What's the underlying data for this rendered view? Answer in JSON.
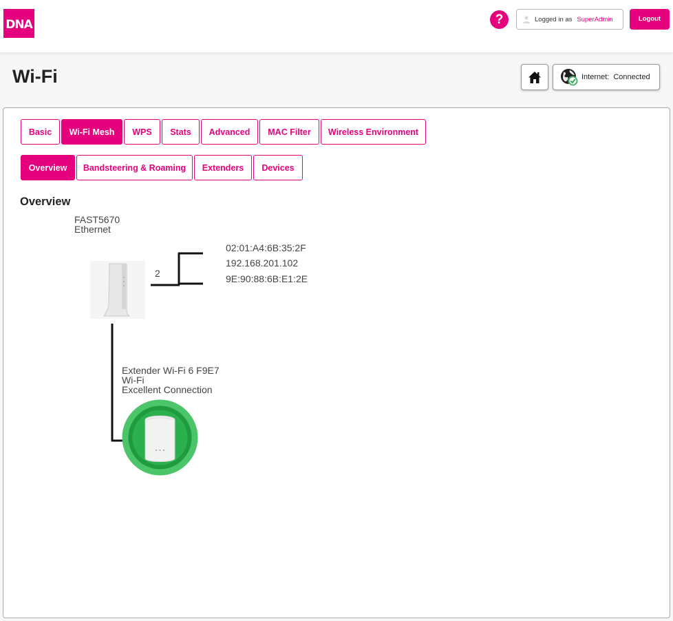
{
  "header": {
    "logo_text": "DNA",
    "help_label": "?",
    "logged_in_label": "Logged in as",
    "username": "SuperAdmin",
    "logout_label": "Logout"
  },
  "page": {
    "title": "Wi-Fi",
    "internet_label": "Internet:",
    "internet_status": "Connected"
  },
  "main_tabs": [
    {
      "label": "Basic",
      "active": false
    },
    {
      "label": "Wi-Fi Mesh",
      "active": true
    },
    {
      "label": "WPS",
      "active": false
    },
    {
      "label": "Stats",
      "active": false
    },
    {
      "label": "Advanced",
      "active": false
    },
    {
      "label": "MAC Filter",
      "active": false
    },
    {
      "label": "Wireless Environment",
      "active": false
    }
  ],
  "sub_tabs": [
    {
      "label": "Overview",
      "active": true
    },
    {
      "label": "Bandsteering & Roaming",
      "active": false
    },
    {
      "label": "Extenders",
      "active": false
    },
    {
      "label": "Devices",
      "active": false
    }
  ],
  "overview": {
    "title": "Overview",
    "router": {
      "name": "FAST5670",
      "connection": "Ethernet",
      "client_count": "2",
      "clients": [
        "02:01:A4:6B:35:2F",
        "192.168.201.102",
        "9E:90:88:6B:E1:2E"
      ]
    },
    "extender": {
      "name": "Extender Wi-Fi 6 F9E7",
      "connection": "Wi-Fi",
      "quality": "Excellent Connection"
    }
  },
  "colors": {
    "brand": "#e5007e",
    "signal_outer": "#4cc46a",
    "signal_inner": "#1f9a3e"
  }
}
